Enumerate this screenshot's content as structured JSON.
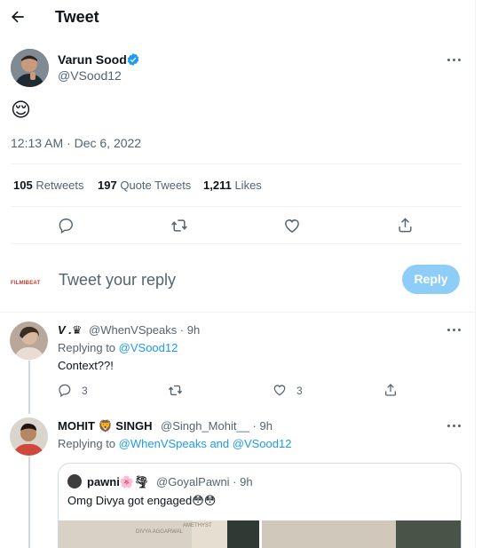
{
  "header": {
    "title": "Tweet"
  },
  "tweet": {
    "author_name": "Varun Sood",
    "handle": "@VSood12",
    "text": "😌",
    "timestamp": "12:13 AM · Dec 6, 2022",
    "retweets_count": "105",
    "retweets_label": "Retweets",
    "quotes_count": "197",
    "quotes_label": "Quote Tweets",
    "likes_count": "1,211",
    "likes_label": "Likes"
  },
  "composer": {
    "logo_text": "FILMIBEAT",
    "placeholder": "Tweet your reply",
    "reply_label": "Reply"
  },
  "replies": [
    {
      "name": "V .♛",
      "handle": "@WhenVSpeaks · 9h",
      "replying_prefix": "Replying to ",
      "replying_to": "@VSood12",
      "text": "Context??!",
      "reply_count": "3",
      "like_count": "3"
    },
    {
      "name": "MOHIT 🦁 SINGH",
      "handle": "@Singh_Mohit__ · 9h",
      "replying_prefix": "Replying to ",
      "replying_to": "@WhenVSpeaks and @VSood12",
      "quote": {
        "name": "pawni🌸🌪",
        "handle": "@GoyalPawni · 9h",
        "text": "Omg Divya got engaged😳😳",
        "img_text_1": "DIVYA AGGARWAL",
        "img_text_2": "AMETHYST"
      }
    }
  ],
  "colors": {
    "accent": "#1d9bf0",
    "reply_disabled": "#8ecdf8",
    "muted": "#536471"
  }
}
